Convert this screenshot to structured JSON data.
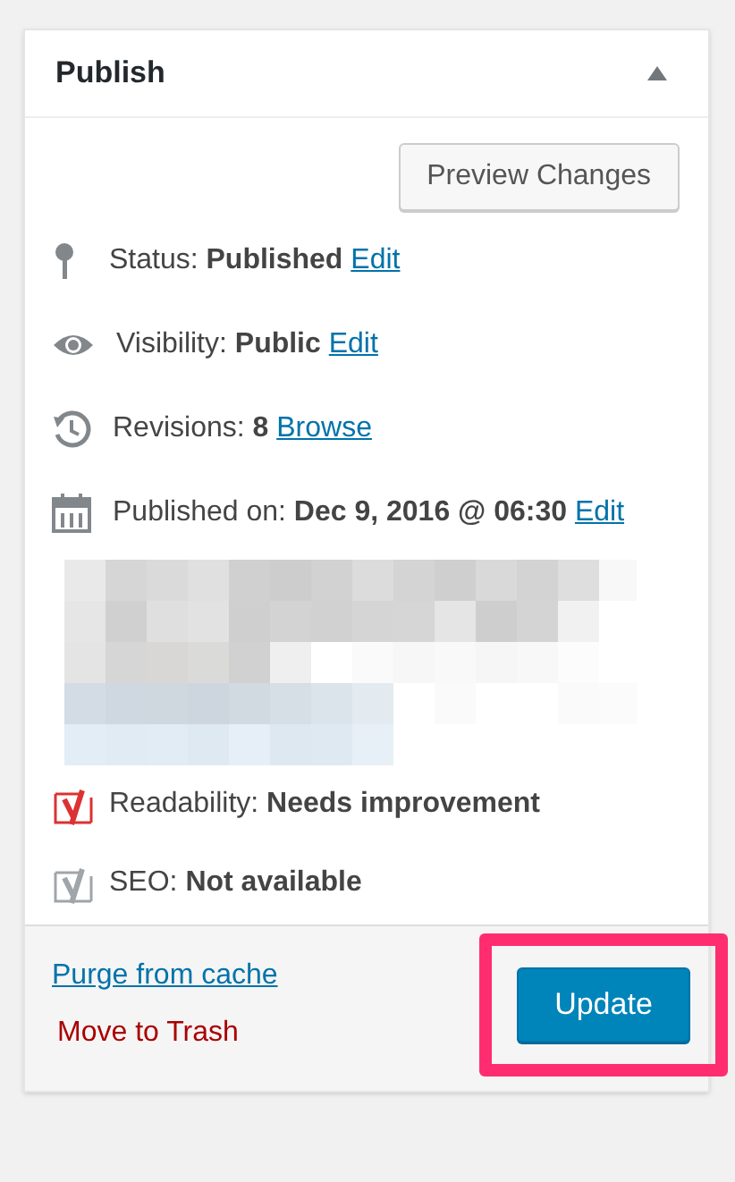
{
  "panel": {
    "title": "Publish",
    "expanded": true
  },
  "preview_button": "Preview Changes",
  "rows": [
    {
      "kind": "status",
      "text": "Status: **Published**",
      "link": "Edit"
    },
    {
      "kind": "visibility",
      "text": "Visibility: **Public**",
      "link": "Edit"
    },
    {
      "kind": "revisions",
      "text": "Revisions: **8**",
      "link": "Browse"
    },
    {
      "kind": "date",
      "text": "Published on: **Dec 9, 2016 @ 06:30**",
      "link": "Edit"
    }
  ],
  "scores": [
    {
      "text": "Readability: **Needs improvement**",
      "color": "#dc3232"
    },
    {
      "text": "SEO: **Not available**",
      "color": "#a0a5aa"
    }
  ],
  "footer": {
    "purge_link": "Purge from cache",
    "trash_link": "Move to Trash",
    "update_button": "Update",
    "highlighted": true
  }
}
